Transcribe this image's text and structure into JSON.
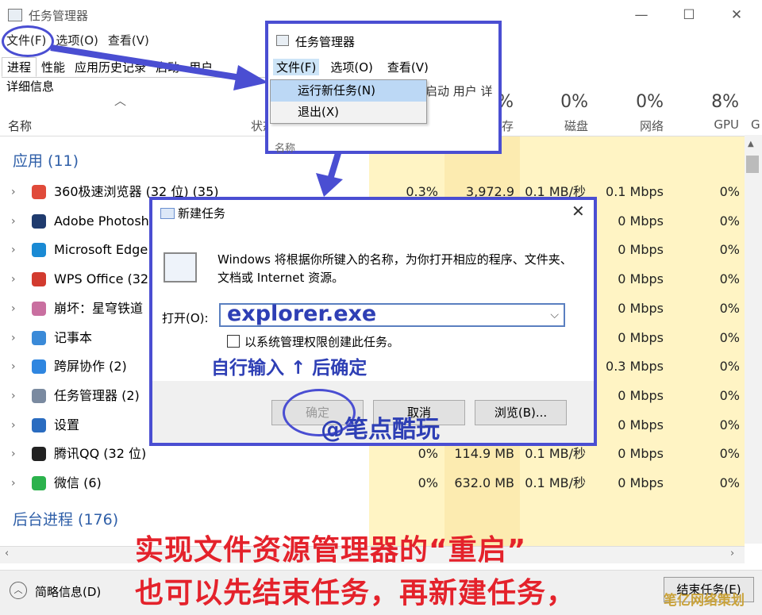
{
  "taskmgr": {
    "title": "任务管理器",
    "menu": [
      "文件(F)",
      "选项(O)",
      "查看(V)"
    ],
    "tabs": [
      "进程",
      "性能",
      "应用历史记录",
      "启动",
      "用户",
      "详细信息"
    ],
    "columns": {
      "name": "名称",
      "status": "状态",
      "memory": {
        "pct": "%",
        "label": "存"
      },
      "disk": {
        "pct": "0%",
        "label": "磁盘"
      },
      "network": {
        "pct": "0%",
        "label": "网络"
      },
      "gpu": {
        "pct": "8%",
        "label": "GPU"
      },
      "gpu_engine": "G"
    },
    "groups": {
      "apps": "应用 (11)",
      "background": "后台进程 (176)"
    },
    "rows": [
      {
        "name": "360极速浏览器 (32 位) (35)",
        "cpu": "0.3%",
        "memory": "3,972.9",
        "disk": "0.1 MB/秒",
        "network": "0.1 Mbps",
        "gpu": "0%"
      },
      {
        "name": "Adobe Photosho",
        "network": "0 Mbps",
        "gpu": "0%"
      },
      {
        "name": "Microsoft Edge",
        "network": "0 Mbps",
        "gpu": "0%"
      },
      {
        "name": "WPS Office (32",
        "network": "0 Mbps",
        "gpu": "0%"
      },
      {
        "name": "崩坏：星穹铁道",
        "network": "0 Mbps",
        "gpu": "0%"
      },
      {
        "name": "记事本",
        "network": "0 Mbps",
        "gpu": "0%"
      },
      {
        "name": "跨屏协作 (2)",
        "network": "0.3 Mbps",
        "gpu": "0%"
      },
      {
        "name": "任务管理器 (2)",
        "network": "0 Mbps",
        "gpu": "0%"
      },
      {
        "name": "设置",
        "network": "0 Mbps",
        "gpu": "0%"
      },
      {
        "name": "腾讯QQ (32 位)",
        "cpu": "0%",
        "memory": "114.9 MB",
        "disk": "0.1 MB/秒",
        "network": "0 Mbps",
        "gpu": "0%"
      },
      {
        "name": "微信 (6)",
        "cpu": "0%",
        "memory": "632.0 MB",
        "disk": "0.1 MB/秒",
        "network": "0 Mbps",
        "gpu": "0%"
      }
    ],
    "footer": {
      "fewer_details": "简略信息(D)",
      "end_task": "结束任务(E)"
    }
  },
  "menu_dialog": {
    "title": "任务管理器",
    "menu": [
      "文件(F)",
      "选项(O)",
      "查看(V)"
    ],
    "dropdown": [
      "运行新任务(N)",
      "退出(X)"
    ],
    "behind_tabs": "启动 用户 详",
    "behind_name": "名称"
  },
  "run_dialog": {
    "title": "新建任务",
    "description": "Windows 将根据你所键入的名称，为你打开相应的程序、文件夹、文档或 Internet 资源。",
    "open_label": "打开(O):",
    "input_value": "explorer.exe",
    "admin_checkbox": "以系统管理权限创建此任务。",
    "ok": "确定",
    "cancel": "取消",
    "browse": "浏览(B)..."
  },
  "annotations": {
    "hint": "自行输入 ↑ 后确定",
    "watermark": "@笔点酷玩",
    "caption_line1": "实现文件资源管理器的“重启”",
    "caption_line2": "也可以先结束任务，再新建任务，",
    "corner": "笔亿网络策划"
  },
  "colors": {
    "accent": "#4a4ed2",
    "caption": "#e4222b",
    "hint": "#2e3fb5",
    "heat": "#fff4c4"
  }
}
